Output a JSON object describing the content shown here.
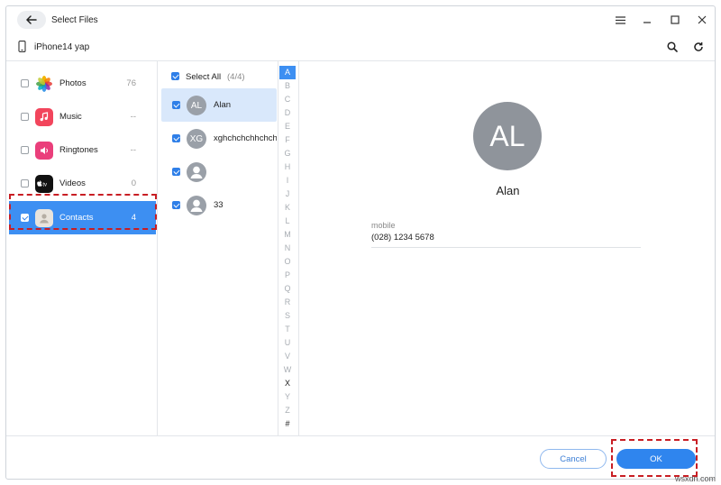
{
  "window": {
    "title": "Select Files"
  },
  "device": {
    "name": "iPhone14 yap"
  },
  "categories": [
    {
      "label": "Photos",
      "count": "76",
      "checked": false,
      "selected": false,
      "icon": "photos-icon"
    },
    {
      "label": "Music",
      "count": "--",
      "checked": false,
      "selected": false,
      "icon": "music-icon"
    },
    {
      "label": "Ringtones",
      "count": "--",
      "checked": false,
      "selected": false,
      "icon": "ringtones-icon"
    },
    {
      "label": "Videos",
      "count": "0",
      "checked": false,
      "selected": false,
      "icon": "tv-icon"
    },
    {
      "label": "Contacts",
      "count": "4",
      "checked": true,
      "selected": true,
      "icon": "contacts-icon"
    }
  ],
  "contacts": {
    "select_all_label": "Select All",
    "select_all_count": "(4/4)",
    "items": [
      {
        "initials": "AL",
        "name": "Alan",
        "checked": true,
        "selected": true
      },
      {
        "initials": "XG",
        "name": "xghchchchhchchc",
        "checked": true,
        "selected": false
      },
      {
        "initials": "",
        "name": "",
        "checked": true,
        "selected": false
      },
      {
        "initials": "",
        "name": "33",
        "checked": true,
        "selected": false
      }
    ]
  },
  "alphabet": {
    "letters": [
      "A",
      "B",
      "C",
      "D",
      "E",
      "F",
      "G",
      "H",
      "I",
      "J",
      "K",
      "L",
      "M",
      "N",
      "O",
      "P",
      "Q",
      "R",
      "S",
      "T",
      "U",
      "V",
      "W",
      "X",
      "Y",
      "Z",
      "#"
    ],
    "active": "A",
    "dark": [
      "X",
      "#"
    ]
  },
  "detail": {
    "initials": "AL",
    "name": "Alan",
    "field_label": "mobile",
    "field_value": "(028) 1234 5678"
  },
  "footer": {
    "cancel_label": "Cancel",
    "ok_label": "OK"
  },
  "watermark": "wsxdn.com",
  "colors": {
    "accent": "#3d8ff2",
    "highlight_dash": "#c81e24"
  }
}
